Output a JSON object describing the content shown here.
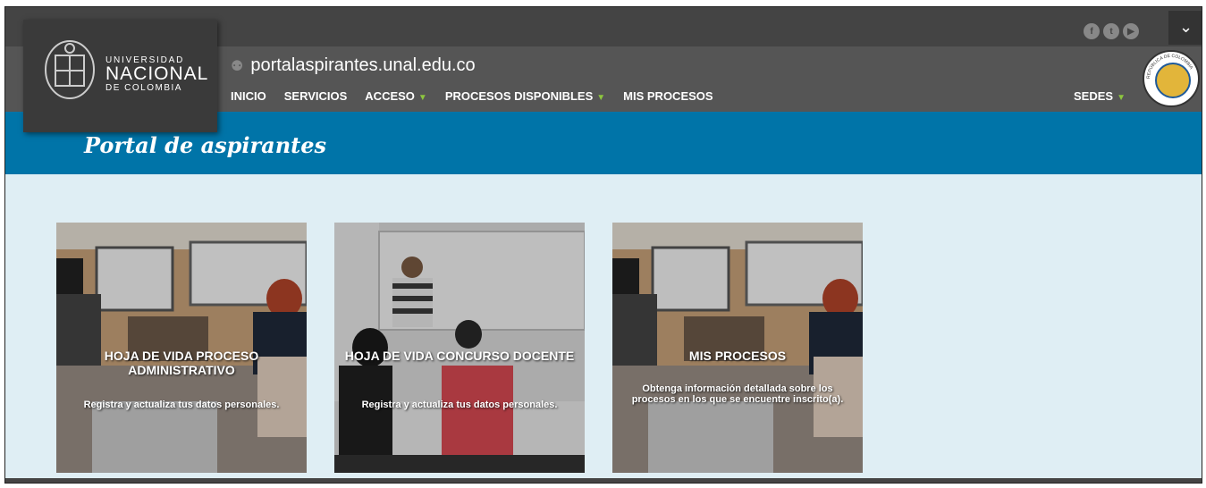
{
  "header": {
    "logo": {
      "line1": "UNIVERSIDAD",
      "line2": "NACIONAL",
      "line3": "DE COLOMBIA"
    },
    "domain": "portalaspirantes.unal.edu.co",
    "menu": [
      "INICIO",
      "SERVICIOS",
      "ACCESO",
      "PROCESOS DISPONIBLES",
      "MIS PROCESOS"
    ],
    "sedes": "SEDES",
    "social_icons": [
      "facebook-icon",
      "twitter-icon",
      "youtube-icon"
    ],
    "seal_text": "REPÚBLICA DE COLOMBIA"
  },
  "banner": {
    "title": "Portal de aspirantes"
  },
  "cards": [
    {
      "title": "HOJA DE VIDA PROCESO ADMINISTRATIVO",
      "subtitle": "Registra y actualiza tus datos personales."
    },
    {
      "title": "HOJA DE VIDA CONCURSO DOCENTE",
      "subtitle": "Registra y actualiza tus datos personales."
    },
    {
      "title": "MIS PROCESOS",
      "subtitle": "Obtenga información detallada sobre los procesos en los que se encuentre inscrito(a)."
    }
  ],
  "colors": {
    "banner": "#0074a8",
    "nav": "#555555",
    "accent": "#8dc63f"
  }
}
